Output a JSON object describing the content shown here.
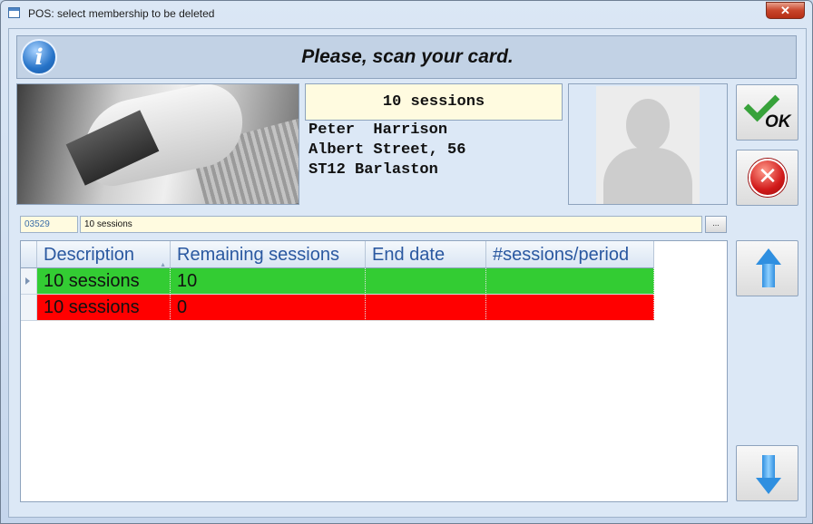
{
  "window": {
    "title": "POS: select membership to be deleted",
    "close_label": "✕"
  },
  "banner": {
    "message": "Please, scan your card.",
    "info_icon": "info-icon"
  },
  "membership": {
    "name": "10 sessions"
  },
  "member": {
    "name_line": "Peter  Harrison",
    "address_line": "Albert Street, 56",
    "city_line": "ST12 Barlaston"
  },
  "buttons": {
    "ok_label": "OK",
    "browse_label": "..."
  },
  "fields": {
    "code": "03529",
    "description": "10 sessions"
  },
  "grid": {
    "columns": [
      "Description",
      "Remaining sessions",
      "End date",
      "#sessions/period"
    ],
    "rows": [
      {
        "description": "10 sessions",
        "remaining": "10",
        "end_date": "",
        "per_period": "",
        "status_color": "#33cc33"
      },
      {
        "description": "10 sessions",
        "remaining": "0",
        "end_date": "",
        "per_period": "",
        "status_color": "#ff0000"
      }
    ]
  },
  "colors": {
    "valid_row": "#33cc33",
    "expired_row": "#ff0000",
    "accent": "#2a58a0"
  }
}
